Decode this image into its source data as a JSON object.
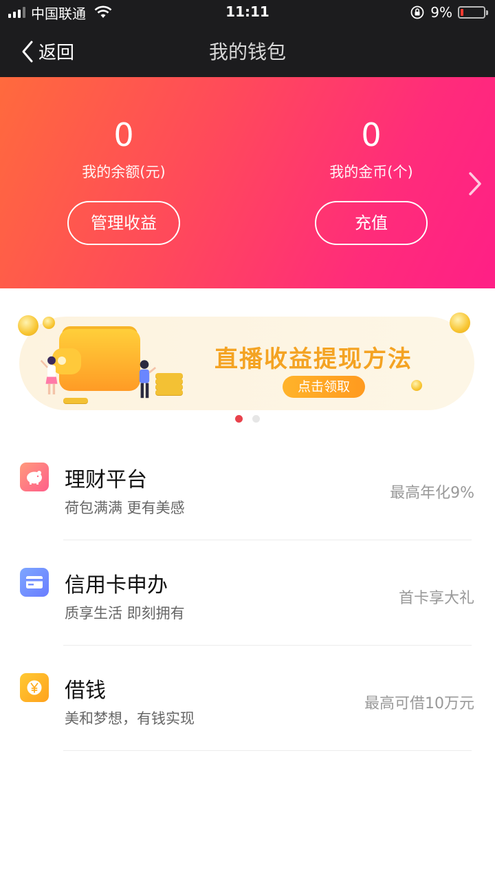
{
  "status_bar": {
    "carrier": "中国联通",
    "time": "11:11",
    "battery_percent": "9%"
  },
  "nav": {
    "back_label": "返回",
    "title": "我的钱包"
  },
  "wallet": {
    "balance_value": "0",
    "balance_label": "我的余额(元)",
    "manage_button": "管理收益",
    "coins_value": "0",
    "coins_label": "我的金币(个)",
    "recharge_button": "充值"
  },
  "banner": {
    "title": "直播收益提现方法",
    "button": "点击领取",
    "page_count": 2,
    "active_index": 0
  },
  "services": [
    {
      "icon": "piggy-bank-icon",
      "title": "理财平台",
      "subtitle": "荷包满满 更有美感",
      "right": "最高年化9%"
    },
    {
      "icon": "credit-card-icon",
      "title": "信用卡申办",
      "subtitle": "质享生活 即刻拥有",
      "right": "首卡享大礼"
    },
    {
      "icon": "yen-coin-icon",
      "title": "借钱",
      "subtitle": "美和梦想，有钱实现",
      "right": "最高可借10万元"
    }
  ],
  "colors": {
    "hero_gradient_start": "#ff6a3d",
    "hero_gradient_end": "#ff1f86",
    "banner_title": "#f4a323",
    "dot_active": "#e8424c"
  }
}
